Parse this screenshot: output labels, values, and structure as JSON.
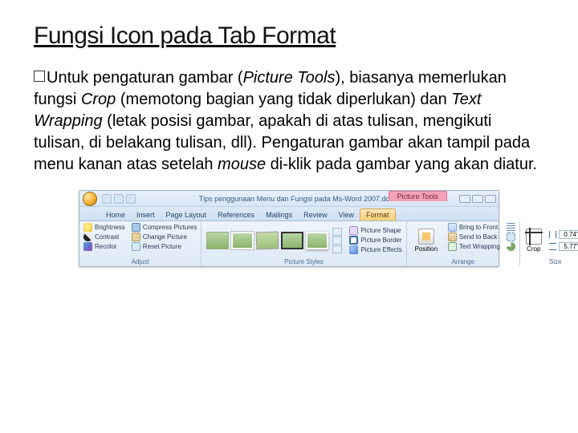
{
  "title": "Fungsi Icon pada Tab Format",
  "paragraph": {
    "lead": "Untuk",
    "p1_a": " pengaturan gambar (",
    "picture_tools": "Picture Tools",
    "p1_b": "), biasanya memerlukan fungsi ",
    "crop": "Crop",
    "p1_c": " (memotong bagian yang tidak diperlukan) dan ",
    "text_wrapping": "Text Wrapping",
    "p1_d": " (letak posisi gambar, apakah di atas tulisan, mengikuti tulisan, di belakang tulisan, dll). Pengaturan gambar akan tampil pada menu kanan atas setelah ",
    "mouse": "mouse",
    "p1_e": " di-klik pada gambar yang akan diatur."
  },
  "ribbon": {
    "titlebar": "Tips penggunaan Menu dan Fungsi pada Ms-Word 2007.do...",
    "context_tab": "Picture Tools",
    "tabs": {
      "home": "Home",
      "insert": "Insert",
      "page_layout": "Page Layout",
      "references": "References",
      "mailings": "Mailings",
      "review": "Review",
      "view": "View",
      "format": "Format"
    },
    "groups": {
      "adjust": {
        "label": "Adjust",
        "brightness": "Brightness",
        "contrast": "Contrast",
        "recolor": "Recolor",
        "compress": "Compress Pictures",
        "change": "Change Picture",
        "reset": "Reset Picture"
      },
      "picture_styles": {
        "label": "Picture Styles",
        "shape": "Picture Shape",
        "border": "Picture Border",
        "effects": "Picture Effects"
      },
      "arrange": {
        "label": "Arrange",
        "position": "Position",
        "bring_front": "Bring to Front",
        "send_back": "Send to Back",
        "text_wrapping": "Text Wrapping",
        "align": "Align",
        "group": "Group",
        "rotate": "Rotate"
      },
      "size": {
        "label": "Size",
        "crop": "Crop",
        "height": "0.74\"",
        "width": "5.77\""
      }
    }
  }
}
